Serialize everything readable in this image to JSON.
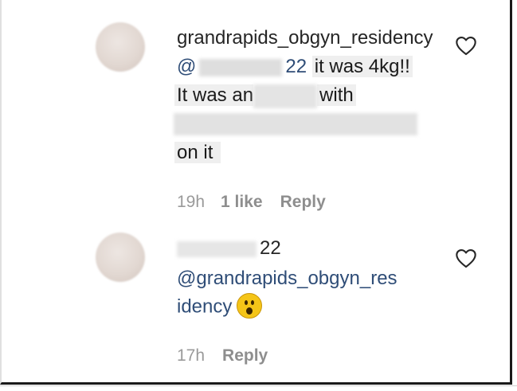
{
  "comments": [
    {
      "username": "grandrapids_obgyn_residency",
      "mention_prefix": "@",
      "mention_suffix": "22",
      "line1_text": "it was 4kg!!",
      "line2_start": "It was an",
      "line2_end": "with",
      "line4_text": "on it",
      "time": "19h",
      "likes": "1 like",
      "reply": "Reply",
      "like_icon": "heart-outline-icon"
    },
    {
      "username_suffix": "22",
      "mention_line1": "@grandrapids_obgyn_res",
      "mention_line2": "idency",
      "emoji": "astonished-face-emoji",
      "time": "17h",
      "reply": "Reply",
      "like_icon": "heart-outline-icon"
    }
  ],
  "colors": {
    "text": "#262626",
    "mention": "#2f4d77",
    "meta": "#8e8e8e"
  }
}
